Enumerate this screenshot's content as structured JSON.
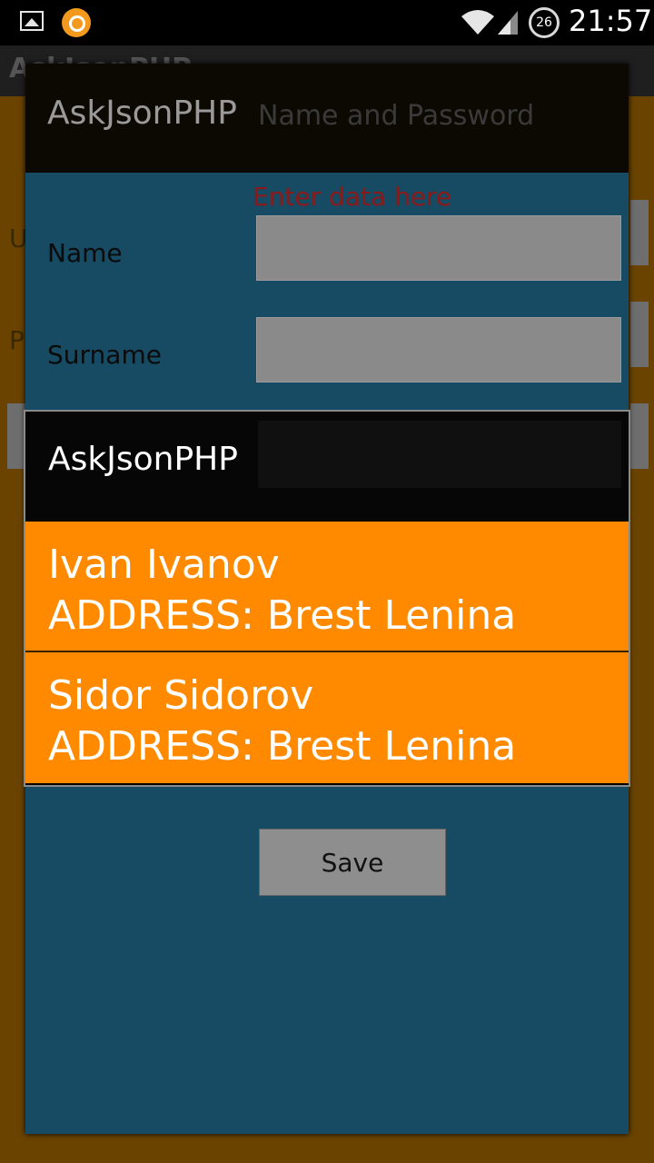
{
  "status_bar": {
    "time": "21:57",
    "sync_badge": "26",
    "icons": [
      "gallery-icon",
      "app-notification-icon",
      "wifi-icon",
      "signal-icon",
      "sync-icon"
    ]
  },
  "activity": {
    "title": "AskJsonPHP",
    "letters": [
      "U",
      "P"
    ]
  },
  "dialog1": {
    "title": "AskJsonPHP",
    "subtitle": "Name and Password",
    "hint": "Enter data here",
    "name_label": "Name",
    "surname_label": "Surname",
    "save_label": "Save"
  },
  "dialog2": {
    "title": "AskJsonPHP",
    "items": [
      {
        "name": "Ivan  Ivanov",
        "address": "ADDRESS:  Brest  Lenina"
      },
      {
        "name": "Sidor  Sidorov",
        "address": "ADDRESS:   Brest  Lenina"
      }
    ]
  },
  "colors": {
    "accent": "#ff8a00",
    "dialog_bg": "#164b63",
    "dim_bg": "#6a4300"
  }
}
